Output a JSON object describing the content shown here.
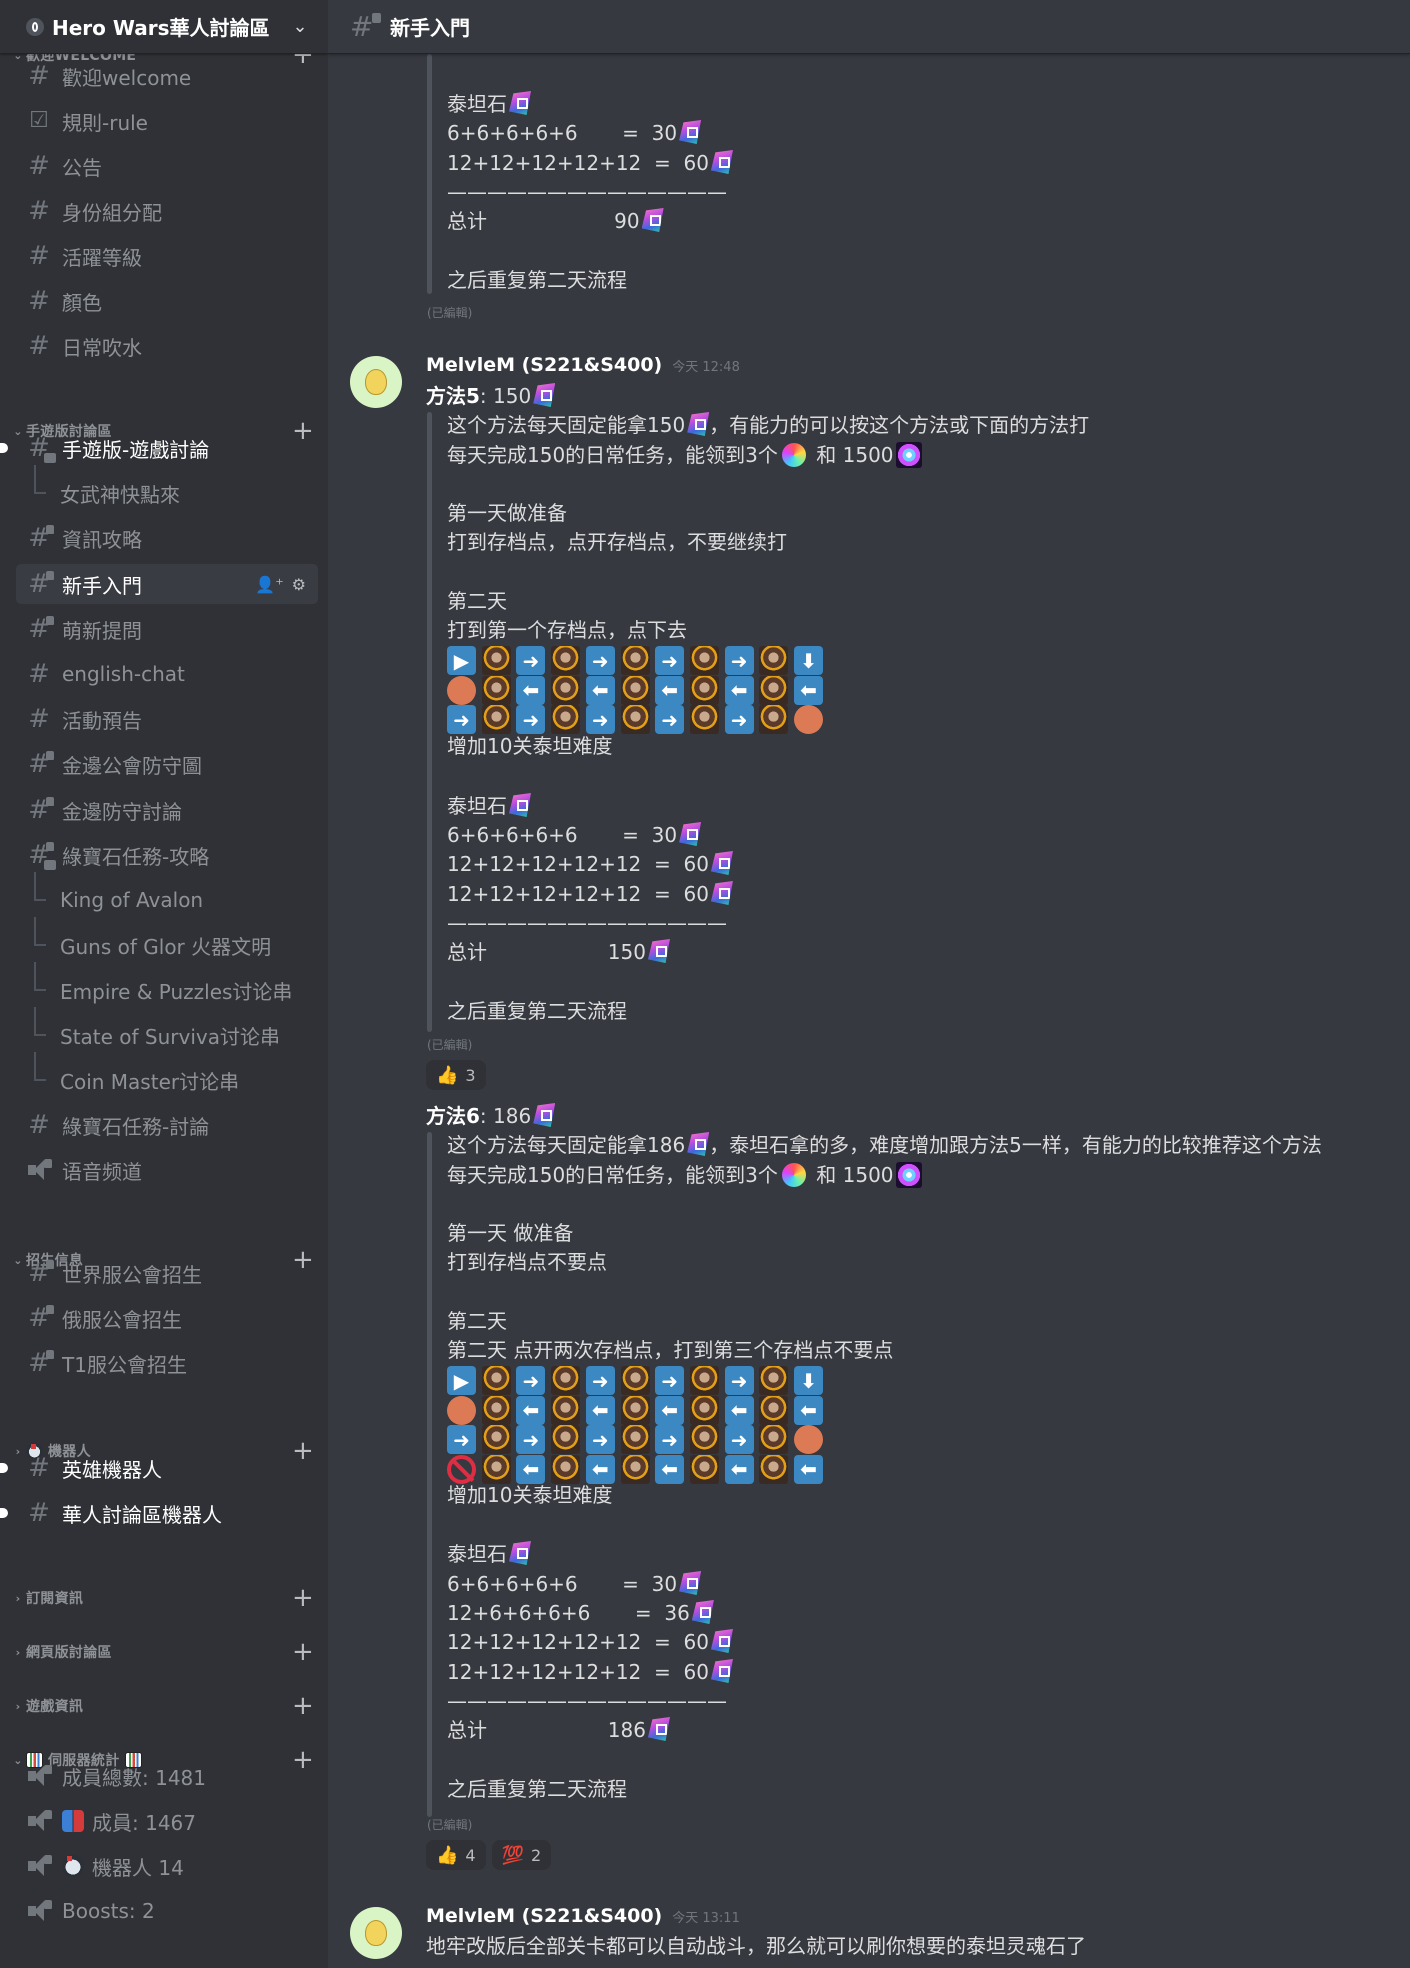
{
  "server": {
    "name": "Hero Wars華人討論區",
    "chevron_icon": "chevron-down-icon"
  },
  "channel_header": {
    "title": "新手入門",
    "icon": "hashtag-lock-icon"
  },
  "sidebar": {
    "categories": [
      {
        "label": "歡迎WELCOME",
        "collapsed": false
      },
      {
        "label": "手遊版討論區",
        "collapsed": false
      },
      {
        "label": "招生信息",
        "collapsed": false
      },
      {
        "label": "機器人",
        "collapsed": true,
        "emoji": "robot-emoji"
      },
      {
        "label": "訂閱資訊",
        "collapsed": true
      },
      {
        "label": "網頁版討論區",
        "collapsed": true
      },
      {
        "label": "遊戲資訊",
        "collapsed": true
      },
      {
        "label": "伺服器統計",
        "collapsed": false,
        "emoji": "bar-chart-emoji"
      }
    ],
    "channels": [
      {
        "label": "歡迎welcome",
        "icon": "hashtag-icon"
      },
      {
        "label": "規則-rule",
        "icon": "rules-checkbox-icon"
      },
      {
        "label": "公告",
        "icon": "hashtag-icon"
      },
      {
        "label": "身份組分配",
        "icon": "hashtag-icon"
      },
      {
        "label": "活躍等級",
        "icon": "hashtag-icon"
      },
      {
        "label": "顏色",
        "icon": "hashtag-icon"
      },
      {
        "label": "日常吹水",
        "icon": "hashtag-icon"
      },
      {
        "label": "手遊版-遊戲討論",
        "icon": "hashtag-thread-icon",
        "unread": true
      },
      {
        "label": "女武神快點來",
        "icon": "thread-icon",
        "thread": true
      },
      {
        "label": "資訊攻略",
        "icon": "hashtag-lock-icon"
      },
      {
        "label": "新手入門",
        "icon": "hashtag-lock-icon",
        "selected": true
      },
      {
        "label": "萌新提問",
        "icon": "hashtag-lock-icon"
      },
      {
        "label": "english-chat",
        "icon": "hashtag-icon"
      },
      {
        "label": "活動預告",
        "icon": "hashtag-icon"
      },
      {
        "label": "金邊公會防守圖",
        "icon": "hashtag-lock-icon"
      },
      {
        "label": "金邊防守討論",
        "icon": "hashtag-lock-icon"
      },
      {
        "label": "綠寶石任務-攻略",
        "icon": "hashtag-lock-thread-icon"
      },
      {
        "label": "King of Avalon",
        "icon": "thread-icon",
        "thread": true
      },
      {
        "label": "Guns of Glor 火器文明",
        "icon": "thread-icon",
        "thread": true
      },
      {
        "label": "Empire & Puzzles讨论串",
        "icon": "thread-icon",
        "thread": true
      },
      {
        "label": "State of Surviva讨论串",
        "icon": "thread-icon",
        "thread": true
      },
      {
        "label": "Coin Master讨论串",
        "icon": "thread-icon",
        "thread": true
      },
      {
        "label": "綠寶石任務-討論",
        "icon": "hashtag-icon"
      },
      {
        "label": "语音频道",
        "icon": "voice-lock-icon"
      },
      {
        "label": "世界服公會招生",
        "icon": "hashtag-lock-icon"
      },
      {
        "label": "俄服公會招生",
        "icon": "hashtag-lock-icon"
      },
      {
        "label": "T1服公會招生",
        "icon": "hashtag-lock-icon"
      },
      {
        "label": "英雄機器人",
        "icon": "hashtag-icon",
        "unread": true
      },
      {
        "label": "華人討論區機器人",
        "icon": "hashtag-icon",
        "unread": true
      },
      {
        "label": "成員總數: 1481",
        "icon": "voice-lock-icon"
      },
      {
        "label": "成員: 1467",
        "icon": "voice-lock-icon",
        "emoji": "couple-emoji"
      },
      {
        "label": "機器人 14",
        "icon": "voice-lock-icon",
        "emoji": "robot-emoji"
      },
      {
        "label": "Boosts: 2",
        "icon": "voice-lock-icon"
      }
    ],
    "selected_actions": [
      "create-invite-icon",
      "settings-gear-icon"
    ]
  },
  "messages": {
    "continued": {
      "lines": [
        "泰坦石",
        "6+6+6+6+6       =  30",
        "12+12+12+12+12  =  60",
        "——————————————",
        "总计                    90",
        "",
        "之后重复第二天流程"
      ],
      "edited": "(已編輯)"
    },
    "method5": {
      "author": "MelvleM (S221&S400)",
      "timestamp": "今天 12:48",
      "title_bold": "方法5",
      "title_rest": ": 150",
      "lines": [
        "这个方法每天固定能拿150",
        "，有能力的可以按这个方法或下面的方法打",
        "每天完成150的日常任务，能领到3个",
        " 和 1500",
        "第一天做准备",
        "打到存档点，点开存档点，不要继续打",
        "第二天",
        "打到第一个存档点，点下去",
        "增加10关泰坦难度",
        "泰坦石",
        "6+6+6+6+6       =  30",
        "12+12+12+12+12  =  60",
        "12+12+12+12+12  =  60",
        "——————————————",
        "总计                   150",
        "之后重复第二天流程"
      ],
      "grid": [
        [
          "play",
          "boss",
          "right",
          "boss",
          "right",
          "boss",
          "right",
          "boss",
          "right",
          "boss",
          "down"
        ],
        [
          "circle",
          "boss",
          "left",
          "boss",
          "left",
          "boss",
          "left",
          "boss",
          "left",
          "boss",
          "left"
        ],
        [
          "right",
          "boss",
          "right",
          "boss",
          "right",
          "boss",
          "right",
          "boss",
          "right",
          "boss",
          "circle"
        ]
      ],
      "edited": "(已編輯)",
      "reactions": [
        {
          "emoji": "👍",
          "name": "thumbs-up",
          "count": "3"
        }
      ]
    },
    "method6": {
      "title_bold": "方法6",
      "title_rest": ": 186",
      "lines": [
        "这个方法每天固定能拿186",
        "，泰坦石拿的多，难度增加跟方法5一样，有能力的比较推荐这个方法",
        "每天完成150的日常任务，能领到3个",
        " 和 1500",
        "第一天 做准备",
        "打到存档点不要点",
        "第二天",
        "第二天 点开两次存档点，打到第三个存档点不要点",
        "增加10关泰坦难度",
        "泰坦石",
        "6+6+6+6+6       =  30",
        "12+6+6+6+6       =  36",
        "12+12+12+12+12  =  60",
        "12+12+12+12+12  =  60",
        "——————————————",
        "总计                   186",
        "之后重复第二天流程"
      ],
      "grid": [
        [
          "play",
          "boss",
          "right",
          "boss",
          "right",
          "boss",
          "right",
          "boss",
          "right",
          "boss",
          "down"
        ],
        [
          "circle",
          "boss",
          "left",
          "boss",
          "left",
          "boss",
          "left",
          "boss",
          "left",
          "boss",
          "left"
        ],
        [
          "right",
          "boss",
          "right",
          "boss",
          "right",
          "boss",
          "right",
          "boss",
          "right",
          "boss",
          "circle"
        ],
        [
          "no-entry",
          "boss",
          "left",
          "boss",
          "left",
          "boss",
          "left",
          "boss",
          "left",
          "boss",
          "left"
        ]
      ],
      "edited": "(已編輯)",
      "reactions": [
        {
          "emoji": "👍",
          "name": "thumbs-up",
          "count": "4"
        },
        {
          "emoji": "💯",
          "name": "hundred-points",
          "count": "2"
        }
      ]
    },
    "last": {
      "author": "MelvleM (S221&S400)",
      "timestamp": "今天 13:11",
      "text": "地牢改版后全部关卡都可以自动战斗，那么就可以刷你想要的泰坦灵魂石了"
    }
  },
  "colors": {
    "sidebar_bg": "#2f3136",
    "main_bg": "#36393f",
    "arrow_tile": "#3b88c3",
    "circle_tile": "#dd7a56",
    "no_entry": "#dd2e44"
  }
}
